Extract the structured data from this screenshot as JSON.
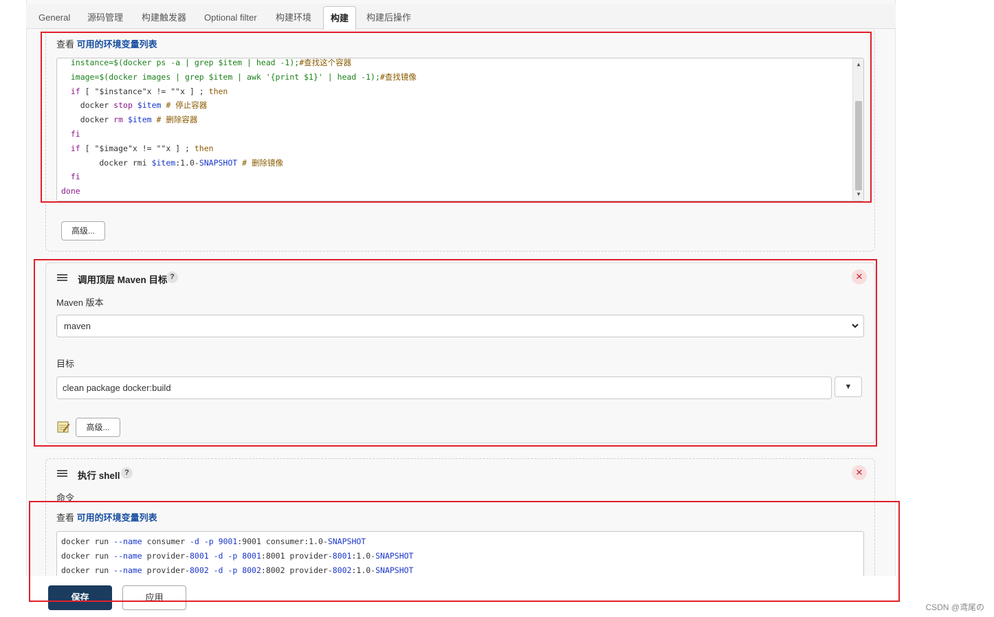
{
  "tabs": [
    "General",
    "源码管理",
    "构建触发器",
    "Optional filter",
    "构建环境",
    "构建",
    "构建后操作"
  ],
  "active_tab": "构建",
  "env_link": {
    "prefix": "查看 ",
    "link": "可用的环境变量列表"
  },
  "script1": {
    "lines": [
      [
        [
          "  instance=$(docker ps -a | grep $item | head -1);",
          "k-green"
        ],
        [
          "#查找这个容器",
          "k-orange"
        ]
      ],
      [
        [
          "  image=$(docker images | grep $item | awk '{print $1}' | head -1);",
          "k-green"
        ],
        [
          "#查找镜像",
          "k-orange"
        ]
      ],
      [
        [
          "  if",
          "k-purple"
        ],
        [
          " [ \"$instance\"x != \"\"x ] ; ",
          ""
        ],
        [
          "then",
          "k-orange"
        ]
      ],
      [
        [
          "    docker ",
          ""
        ],
        [
          "stop",
          "k-purple"
        ],
        [
          " $item",
          "k-blue"
        ],
        [
          " # 停止容器",
          "k-orange"
        ]
      ],
      [
        [
          "    docker ",
          ""
        ],
        [
          "rm",
          "k-purple"
        ],
        [
          " $item",
          "k-blue"
        ],
        [
          " # 删除容器",
          "k-orange"
        ]
      ],
      [
        [
          "  fi",
          "k-purple"
        ]
      ],
      [
        [
          "  if",
          "k-purple"
        ],
        [
          " [ \"$image\"x != \"\"x ] ; ",
          ""
        ],
        [
          "then",
          "k-orange"
        ]
      ],
      [
        [
          "        docker rmi ",
          ""
        ],
        [
          "$item",
          "k-blue"
        ],
        [
          ":1.0-",
          ""
        ],
        [
          "SNAPSHOT",
          "k-blue"
        ],
        [
          " # 删除镜像",
          "k-orange"
        ]
      ],
      [
        [
          "  fi",
          "k-purple"
        ]
      ],
      [
        [
          "done",
          "k-purple"
        ]
      ]
    ]
  },
  "advanced_label": "高级...",
  "maven_step": {
    "title": "调用顶层 Maven 目标",
    "help": "?",
    "close": "✕",
    "version_label": "Maven 版本",
    "version_value": "maven",
    "goals_label": "目标",
    "goals_value": "clean package docker:build",
    "dropdown_arrow": "▼",
    "advanced_label": "高级..."
  },
  "shell_step": {
    "title": "执行 shell",
    "help": "?",
    "close": "✕",
    "command_label": "命令"
  },
  "script2": {
    "lines": [
      [
        [
          "docker run ",
          ""
        ],
        [
          "--name",
          "k-blue"
        ],
        [
          " consumer ",
          ""
        ],
        [
          "-d",
          "k-blue"
        ],
        [
          " ",
          ""
        ],
        [
          "-p",
          "k-blue"
        ],
        [
          " ",
          ""
        ],
        [
          "9001",
          "k-blue"
        ],
        [
          ":9001 consumer:1.0-",
          ""
        ],
        [
          "SNAPSHOT",
          "k-blue"
        ]
      ],
      [
        [
          "docker run ",
          ""
        ],
        [
          "--name",
          "k-blue"
        ],
        [
          " provider-",
          ""
        ],
        [
          "8001",
          "k-blue"
        ],
        [
          " ",
          ""
        ],
        [
          "-d",
          "k-blue"
        ],
        [
          " ",
          ""
        ],
        [
          "-p",
          "k-blue"
        ],
        [
          " ",
          ""
        ],
        [
          "8001",
          "k-blue"
        ],
        [
          ":8001 provider-",
          ""
        ],
        [
          "8001",
          "k-blue"
        ],
        [
          ":1.0-",
          ""
        ],
        [
          "SNAPSHOT",
          "k-blue"
        ]
      ],
      [
        [
          "docker run ",
          ""
        ],
        [
          "--name",
          "k-blue"
        ],
        [
          " provider-",
          ""
        ],
        [
          "8002",
          "k-blue"
        ],
        [
          " ",
          ""
        ],
        [
          "-d",
          "k-blue"
        ],
        [
          " ",
          ""
        ],
        [
          "-p",
          "k-blue"
        ],
        [
          " ",
          ""
        ],
        [
          "8002",
          "k-blue"
        ],
        [
          ":8002 provider-",
          ""
        ],
        [
          "8002",
          "k-blue"
        ],
        [
          ":1.0-",
          ""
        ],
        [
          "SNAPSHOT",
          "k-blue"
        ]
      ]
    ]
  },
  "footer": {
    "save": "保存",
    "apply": "应用"
  },
  "watermark": "CSDN @鸢尾の",
  "colors": {
    "highlight": "#e0202a",
    "save_bg": "#1b3b5f",
    "link": "#1a4fa0"
  }
}
